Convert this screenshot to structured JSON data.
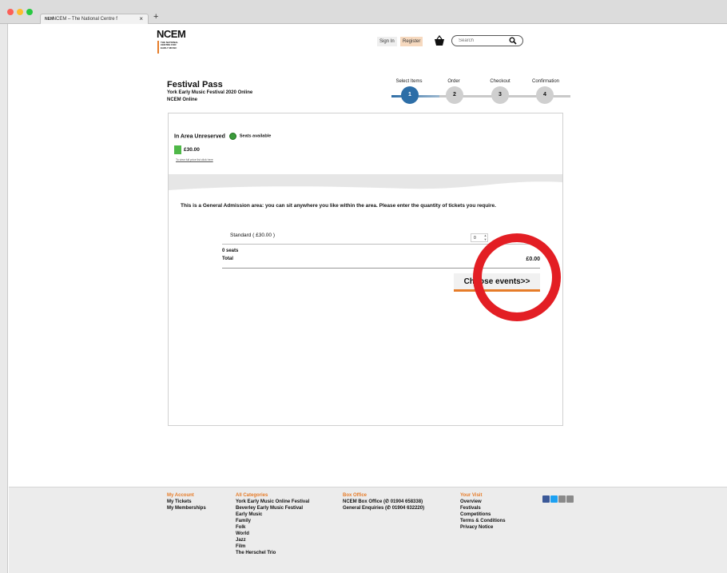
{
  "browser": {
    "tab_title": "NCEM – The National Centre f",
    "tab_favicon": "NEM",
    "tab_close": "×",
    "new_tab": "+"
  },
  "header": {
    "logo_text": "NCEM",
    "logo_subtext": "THE NATIONAL CENTRE FOR EARLY MUSIC",
    "sign_in": "Sign In",
    "register": "Register",
    "search_placeholder": "Search"
  },
  "event": {
    "title": "Festival Pass",
    "subtitle": "York Early Music Festival 2020 Online",
    "venue": "NCEM Online"
  },
  "steps": [
    {
      "label": "Select Items",
      "number": "1",
      "active": true
    },
    {
      "label": "Order",
      "number": "2",
      "active": false
    },
    {
      "label": "Checkout",
      "number": "3",
      "active": false
    },
    {
      "label": "Confirmation",
      "number": "4",
      "active": false
    }
  ],
  "area": {
    "title": "In Area Unreserved",
    "availability": "Seats available",
    "price": "£30.00",
    "price_list_link": "To view full price list click here",
    "intro": "This is a General Admission area: you can sit anywhere you like within the area. Please enter the quantity of tickets you require."
  },
  "tickets": {
    "row_label": "Standard ( £30.00 )",
    "quantity": "0",
    "seats": "0 seats",
    "total_label": "Total",
    "total_value": "£0.00",
    "choose_button": "Choose events>>"
  },
  "footer": {
    "col1": {
      "heading": "My Account",
      "items": [
        "My Tickets",
        "My Memberships"
      ]
    },
    "col2": {
      "heading": "All Categories",
      "items": [
        "York Early Music Online Festival",
        "Beverley Early Music Festival",
        "Early Music",
        "Family",
        "Folk",
        "World",
        "Jazz",
        "Film",
        "The Herschel Trio"
      ]
    },
    "col3": {
      "heading": "Box Office",
      "items": [
        "NCEM Box Office (✆ 01904 658338)",
        "General Enquiries (✆ 01904 632220)"
      ]
    },
    "col4": {
      "heading": "Your Visit",
      "items": [
        "Overview",
        "Festivals",
        "Competitions",
        "Terms & Conditions",
        "Privacy Notice"
      ]
    }
  },
  "colors": {
    "accent_orange": "#e67c29",
    "step_active_blue": "#2d6ea7",
    "annotation_red": "#e31e24"
  }
}
